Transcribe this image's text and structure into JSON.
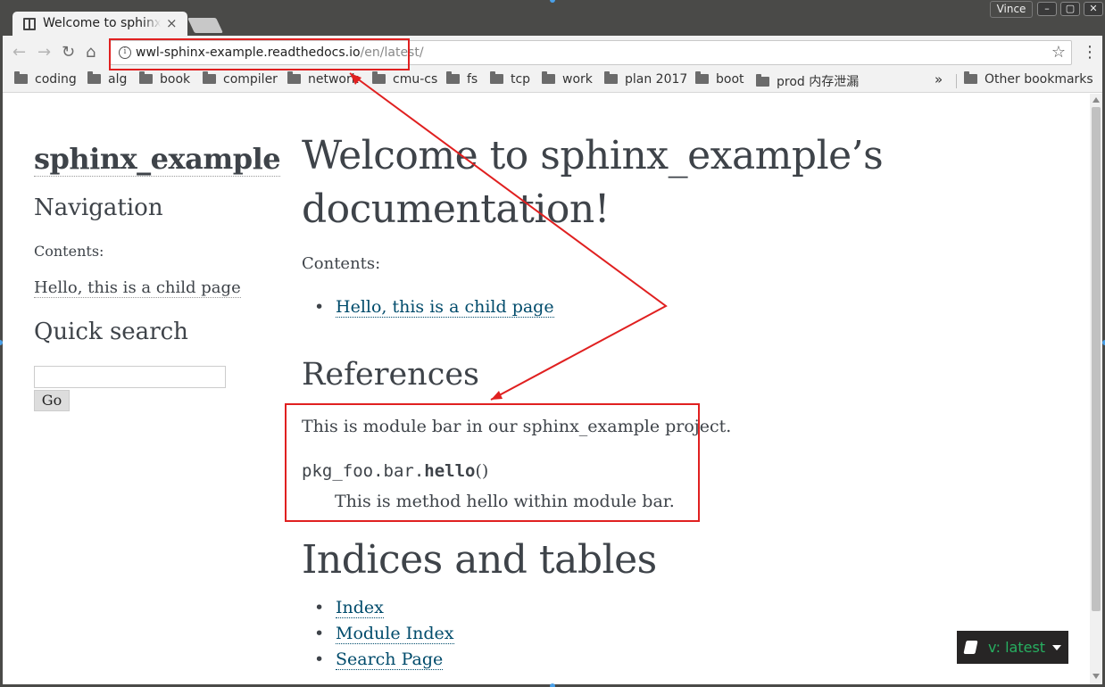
{
  "browser": {
    "tab_title": "Welcome to sphinx_example's documentation",
    "tab_close": "×",
    "user_name": "Vince",
    "window_buttons": [
      "–",
      "▢",
      "✕"
    ],
    "url_host": "wwl-sphinx-example.readthedocs.io",
    "url_path": "/en/latest/",
    "bookmarks": [
      "coding",
      "alg",
      "book",
      "compiler",
      "network",
      "cmu-cs",
      "fs",
      "tcp",
      "work",
      "plan 2017",
      "boot",
      "prod 内存泄漏"
    ],
    "bookmarks_overflow": "»",
    "other_bookmarks": "Other bookmarks"
  },
  "sidebar": {
    "project_title": "sphinx_example",
    "navigation_heading": "Navigation",
    "contents_caption": "Contents:",
    "nav_link": "Hello, this is a child page",
    "quick_search_heading": "Quick search",
    "search_value": "",
    "go_button": "Go"
  },
  "main": {
    "title_line1": "Welcome to sphinx_example’s",
    "title_line2": "documentation!",
    "contents_caption": "Contents:",
    "toc_link": "Hello, this is a child page",
    "references_heading": "References",
    "module_description": "This is module bar in our sphinx_example project.",
    "sig_module": "pkg_foo.bar.",
    "sig_name": "hello",
    "sig_paren": "()",
    "method_description": "This is method hello within module bar.",
    "indices_heading": "Indices and tables",
    "index_links": [
      "Index",
      "Module Index",
      "Search Page"
    ]
  },
  "rtd_badge": {
    "label": "v: latest"
  },
  "colors": {
    "annotation": "#e02020",
    "link": "#004b6b",
    "text": "#3e4349",
    "badge_text": "#27ae60"
  }
}
